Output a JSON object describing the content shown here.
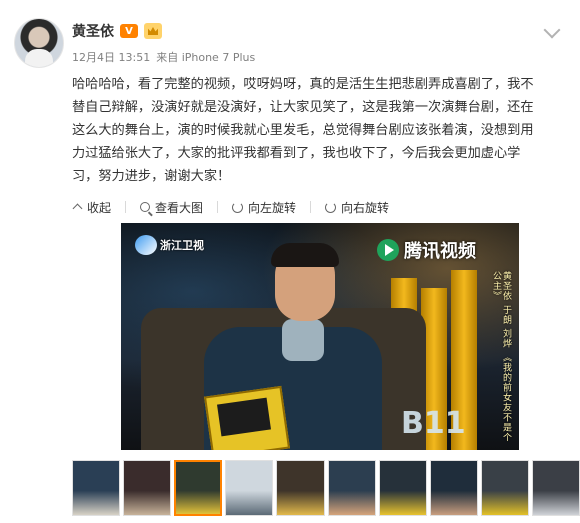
{
  "post": {
    "author": "黄圣依",
    "vip_badge": "V",
    "timestamp": "12月4日 13:51",
    "source": "来自 iPhone 7 Plus",
    "text": "哈哈哈哈，看了完整的视频，哎呀妈呀，真的是活生生把悲剧弄成喜剧了，我不\n替自己辩解，没演好就是没演好，让大家见笑了，这是我第一次演舞台剧，还在\n这么大的舞台上，演的时候我就心里发毛，总觉得舞台剧应该张着演，没想到用\n力过猛给张大了，大家的批评我都看到了，我也收下了，今后我会更加虚心学\n习，努力进步，谢谢大家！"
  },
  "actions": [
    {
      "label": "收起",
      "icon": "collapse-icon"
    },
    {
      "label": "查看大图",
      "icon": "search-icon"
    },
    {
      "label": "向左旋转",
      "icon": "rotate-left-icon"
    },
    {
      "label": "向右旋转",
      "icon": "rotate-right-icon"
    }
  ],
  "image": {
    "channel_logo": "浙江卫视",
    "video_logo": "腾讯视频",
    "side_caption": "黄圣依 于朗 刘烨 《我的前女友不是个公主》",
    "stage_number": "B11"
  },
  "thumbnails": {
    "count": 10,
    "selected_index": 2
  },
  "colors": {
    "accent": "#ff8200",
    "text": "#333333",
    "meta": "#808080"
  }
}
